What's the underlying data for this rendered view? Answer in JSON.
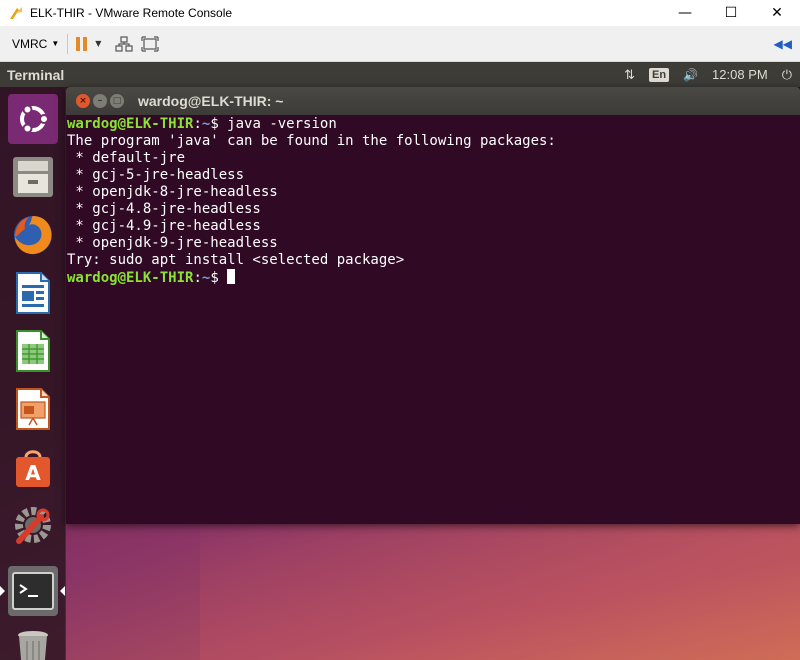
{
  "window": {
    "title": "ELK-THIR - VMware Remote Console",
    "min_glyph": "—",
    "max_glyph": "☐",
    "close_glyph": "✕"
  },
  "toolbar": {
    "menu_label": "VMRC",
    "right_glyph": "◀◀"
  },
  "ubuntu_panel": {
    "app_title": "Terminal",
    "language": "En",
    "time": "12:08 PM",
    "network_glyph": "⇅",
    "volume_glyph": "🔊",
    "power_glyph": "⏻"
  },
  "launcher": {
    "items": [
      "ubuntu-dash",
      "files",
      "firefox",
      "libreoffice-writer",
      "libreoffice-calc",
      "libreoffice-impress",
      "ubuntu-software",
      "system-settings",
      "terminal",
      "trash"
    ]
  },
  "terminal": {
    "title": "wardog@ELK-THIR: ~",
    "lines": [
      {
        "type": "prompt",
        "user": "wardog@ELK-THIR",
        "sep": ":",
        "path": "~",
        "symbol": "$ ",
        "cmd": "java -version"
      },
      {
        "type": "output",
        "text": "The program 'java' can be found in the following packages:"
      },
      {
        "type": "output",
        "text": " * default-jre"
      },
      {
        "type": "output",
        "text": " * gcj-5-jre-headless"
      },
      {
        "type": "output",
        "text": " * openjdk-8-jre-headless"
      },
      {
        "type": "output",
        "text": " * gcj-4.8-jre-headless"
      },
      {
        "type": "output",
        "text": " * gcj-4.9-jre-headless"
      },
      {
        "type": "output",
        "text": " * openjdk-9-jre-headless"
      },
      {
        "type": "output",
        "text": "Try: sudo apt install <selected package>"
      },
      {
        "type": "prompt",
        "user": "wardog@ELK-THIR",
        "sep": ":",
        "path": "~",
        "symbol": "$ ",
        "cmd": ""
      }
    ]
  },
  "colors": {
    "terminal_bg": "#300a24",
    "prompt_user": "#8ae234",
    "prompt_path": "#729fcf",
    "panel_bg": "#3d3c37"
  }
}
